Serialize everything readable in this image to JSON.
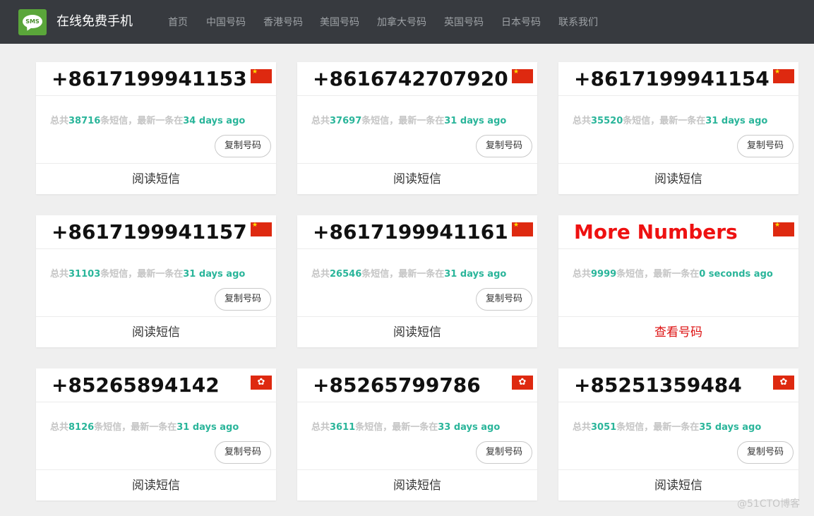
{
  "navbar": {
    "logo_text": "SMS",
    "brand": "在线免费手机",
    "items": [
      "首页",
      "中国号码",
      "香港号码",
      "美国号码",
      "加拿大号码",
      "英国号码",
      "日本号码",
      "联系我们"
    ]
  },
  "cards": [
    {
      "number": "+8617199941153",
      "flag": "china",
      "stat_prefix": "总共",
      "count": "38716",
      "stat_mid": "条短信，最新一条在",
      "time": "34 days ago",
      "copy_label": "复制号码",
      "footer": "阅读短信"
    },
    {
      "number": "+8616742707920",
      "flag": "china",
      "stat_prefix": "总共",
      "count": "37697",
      "stat_mid": "条短信，最新一条在",
      "time": "31 days ago",
      "copy_label": "复制号码",
      "footer": "阅读短信"
    },
    {
      "number": "+8617199941154",
      "flag": "china",
      "stat_prefix": "总共",
      "count": "35520",
      "stat_mid": "条短信，最新一条在",
      "time": "31 days ago",
      "copy_label": "复制号码",
      "footer": "阅读短信"
    },
    {
      "number": "+8617199941157",
      "flag": "china",
      "stat_prefix": "总共",
      "count": "31103",
      "stat_mid": "条短信，最新一条在",
      "time": "31 days ago",
      "copy_label": "复制号码",
      "footer": "阅读短信"
    },
    {
      "number": "+8617199941161",
      "flag": "china",
      "stat_prefix": "总共",
      "count": "26546",
      "stat_mid": "条短信，最新一条在",
      "time": "31 days ago",
      "copy_label": "复制号码",
      "footer": "阅读短信"
    },
    {
      "number": "More Numbers",
      "flag": "china",
      "stat_prefix": "总共",
      "count": "9999",
      "stat_mid": "条短信，最新一条在",
      "time": "0 seconds ago",
      "copy_label": "",
      "footer": "查看号码"
    },
    {
      "number": "+85265894142",
      "flag": "hongkong",
      "stat_prefix": "总共",
      "count": "8126",
      "stat_mid": "条短信，最新一条在",
      "time": "31 days ago",
      "copy_label": "复制号码",
      "footer": "阅读短信"
    },
    {
      "number": "+85265799786",
      "flag": "hongkong",
      "stat_prefix": "总共",
      "count": "3611",
      "stat_mid": "条短信，最新一条在",
      "time": "33 days ago",
      "copy_label": "复制号码",
      "footer": "阅读短信"
    },
    {
      "number": "+85251359484",
      "flag": "hongkong",
      "stat_prefix": "总共",
      "count": "3051",
      "stat_mid": "条短信，最新一条在",
      "time": "35 days ago",
      "copy_label": "复制号码",
      "footer": "阅读短信"
    }
  ],
  "watermark": "@51CTO博客"
}
